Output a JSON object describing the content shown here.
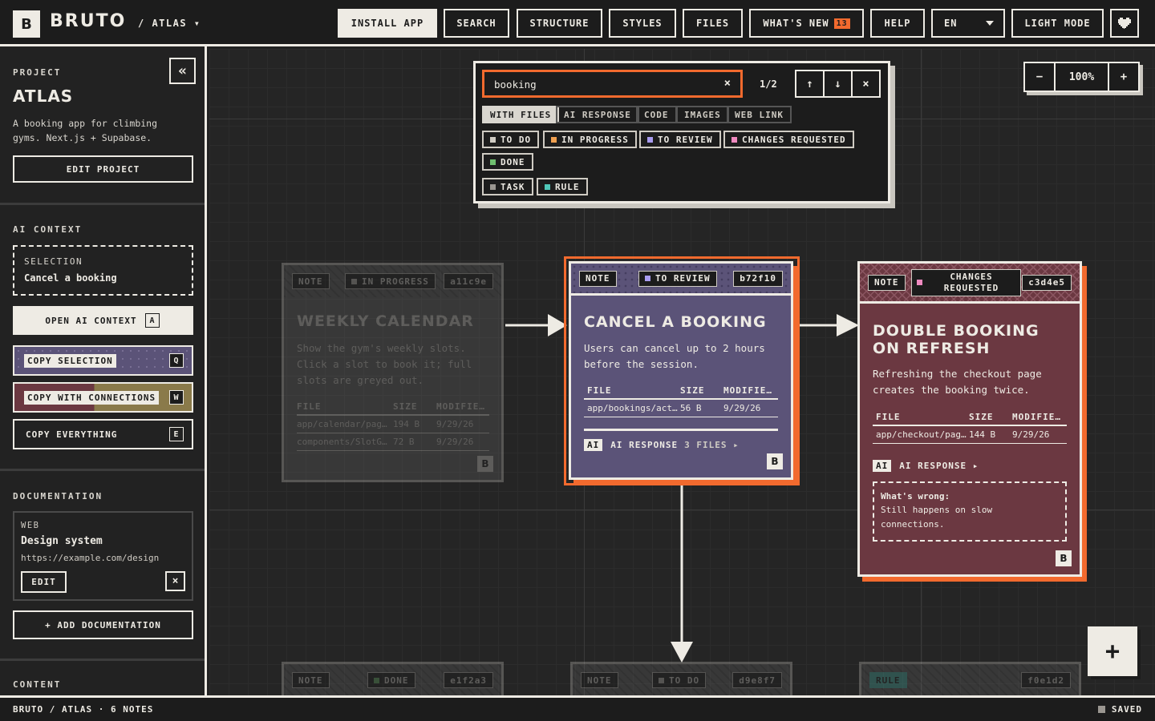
{
  "app": {
    "logo_letter": "B",
    "name": "BRUTO",
    "breadcrumb": "/ ATLAS ▾"
  },
  "topnav": {
    "install": "INSTALL APP",
    "search": "SEARCH",
    "structure": "STRUCTURE",
    "styles": "STYLES",
    "files": "FILES",
    "whats_new": "WHAT'S NEW",
    "whats_new_count": "13",
    "help": "HELP",
    "language": "EN",
    "light_mode": "LIGHT MODE",
    "heart_icon": "heart-icon"
  },
  "sidebar": {
    "project_label": "PROJECT",
    "project_name": "ATLAS",
    "project_desc": "A booking app for climbing gyms. Next.js + Supabase.",
    "edit_project": "EDIT PROJECT",
    "collapse_glyph": "«",
    "ai_context_label": "AI CONTEXT",
    "selection_label": "SELECTION",
    "selection_value": "Cancel a booking",
    "open_ai_context": "OPEN AI CONTEXT",
    "open_ai_key": "A",
    "copy_selection": "COPY SELECTION",
    "copy_selection_key": "Q",
    "copy_with_connections": "COPY WITH CONNECTIONS",
    "copy_with_connections_key": "W",
    "copy_everything": "COPY EVERYTHING",
    "copy_everything_key": "E",
    "documentation_label": "DOCUMENTATION",
    "doc_type": "WEB",
    "doc_title": "Design system",
    "doc_url": "https://example.com/design",
    "doc_edit": "EDIT",
    "doc_remove": "×",
    "add_doc": "+ ADD DOCUMENTATION",
    "content_label": "CONTENT"
  },
  "search": {
    "query": "booking",
    "clear": "×",
    "counter": "1/2",
    "prev": "↑",
    "next": "↓",
    "close": "×",
    "filters": [
      "WITH FILES",
      "AI RESPONSE",
      "CODE",
      "IMAGES",
      "WEB LINK"
    ],
    "statuses": [
      {
        "label": "TO DO",
        "color": "#cfcbc3"
      },
      {
        "label": "IN PROGRESS",
        "color": "#f0a050"
      },
      {
        "label": "TO REVIEW",
        "color": "#a99cf0"
      },
      {
        "label": "CHANGES REQUESTED",
        "color": "#f08ac0"
      },
      {
        "label": "DONE",
        "color": "#6fbf6f"
      }
    ],
    "types": [
      {
        "label": "TASK",
        "color": "#9a9690"
      },
      {
        "label": "RULE",
        "color": "#4fc7b8"
      }
    ]
  },
  "zoom": {
    "minus": "−",
    "level": "100%",
    "plus": "+"
  },
  "cards": {
    "weekly": {
      "type": "NOTE",
      "status": "IN PROGRESS",
      "id": "a11c9e",
      "title": "WEEKLY CALENDAR",
      "desc": "Show the gym's weekly slots. Click a slot to book it; full slots are greyed out.",
      "cols": [
        "FILE",
        "SIZE",
        "MODIFIE…"
      ],
      "rows": [
        [
          "app/calendar/pag…",
          "194 B",
          "9/29/26"
        ],
        [
          "components/SlotG…",
          "72 B",
          "9/29/26"
        ]
      ],
      "mark": "B"
    },
    "cancel": {
      "type": "NOTE",
      "status": "TO REVIEW",
      "id": "b72f10",
      "title": "CANCEL A BOOKING",
      "desc": "Users can cancel up to 2 hours before the session.",
      "cols": [
        "FILE",
        "SIZE",
        "MODIFIE…"
      ],
      "rows": [
        [
          "app/bookings/act…",
          "56 B",
          "9/29/26"
        ]
      ],
      "ai_tag": "AI",
      "ai_label": "AI RESPONSE",
      "ai_files": "3 FILES ▸",
      "mark": "B"
    },
    "double": {
      "type": "NOTE",
      "status": "CHANGES REQUESTED",
      "id": "c3d4e5",
      "title": "DOUBLE BOOKING ON REFRESH",
      "desc": "Refreshing the checkout page creates the booking twice.",
      "cols": [
        "FILE",
        "SIZE",
        "MODIFIE…"
      ],
      "rows": [
        [
          "app/checkout/pag…",
          "144 B",
          "9/29/26"
        ]
      ],
      "ai_tag": "AI",
      "ai_label": "AI RESPONSE ▸",
      "wrong_title": "What's wrong:",
      "wrong_text": "Still happens on slow connections.",
      "mark": "B"
    },
    "bottom1": {
      "type": "NOTE",
      "status": "DONE",
      "id": "e1f2a3"
    },
    "bottom2": {
      "type": "NOTE",
      "status": "TO DO",
      "id": "d9e8f7"
    },
    "bottom3": {
      "type": "RULE",
      "id": "f0e1d2"
    }
  },
  "fab": "+",
  "footer": {
    "path": "BRUTO / ATLAS · 6 NOTES",
    "status": "SAVED"
  },
  "colors": {
    "accent": "#f26a2e",
    "review_purple": "#5b5378",
    "changes_maroon": "#6b3841",
    "cream": "#eeebe4"
  }
}
